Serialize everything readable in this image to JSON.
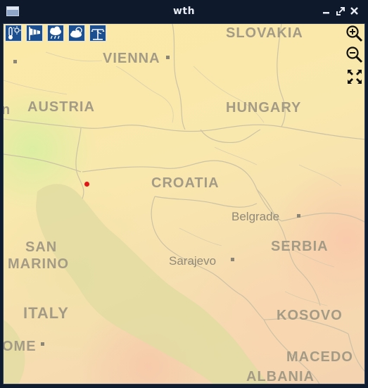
{
  "window": {
    "title": "wth",
    "controls": [
      "minimize",
      "maximize",
      "close"
    ]
  },
  "toolbar": {
    "tools": [
      {
        "name": "temperature-icon"
      },
      {
        "name": "wind-icon"
      },
      {
        "name": "precipitation-icon"
      },
      {
        "name": "cloud-icon"
      },
      {
        "name": "station-icon"
      }
    ]
  },
  "map_controls": {
    "zoom_in": "zoom-in-icon",
    "zoom_out": "zoom-out-icon",
    "fit": "fit-extent-icon"
  },
  "map": {
    "countries": {
      "slovakia": "SLOVAKIA",
      "austria": "AUSTRIA",
      "hungary": "HUNGARY",
      "croatia": "CROATIA",
      "san": "SAN",
      "marino": "MARINO",
      "serbia": "SERBIA",
      "italy": "ITALY",
      "kosovo": "KOSOVO",
      "macedonia": "MACEDO",
      "albania": "ALBANIA",
      "slovenia_partial": "n"
    },
    "cities": {
      "vienna": "VIENNA",
      "belgrade": "Belgrade",
      "sarajevo": "Sarajevo",
      "rome": "OME"
    },
    "colors": {
      "sea": "#dfd9a0",
      "land_base": "#f9e8ad",
      "border": "#c8bfa5",
      "marker": "#e0151a",
      "tool_bg": "#1c4f8f"
    }
  }
}
